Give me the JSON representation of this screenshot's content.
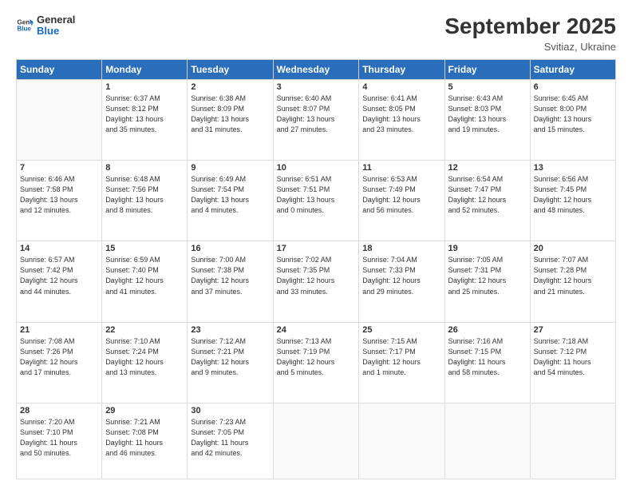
{
  "header": {
    "logo_general": "General",
    "logo_blue": "Blue",
    "month_title": "September 2025",
    "subtitle": "Svitiaz, Ukraine"
  },
  "weekdays": [
    "Sunday",
    "Monday",
    "Tuesday",
    "Wednesday",
    "Thursday",
    "Friday",
    "Saturday"
  ],
  "weeks": [
    [
      {
        "day": "",
        "info": ""
      },
      {
        "day": "1",
        "info": "Sunrise: 6:37 AM\nSunset: 8:12 PM\nDaylight: 13 hours\nand 35 minutes."
      },
      {
        "day": "2",
        "info": "Sunrise: 6:38 AM\nSunset: 8:09 PM\nDaylight: 13 hours\nand 31 minutes."
      },
      {
        "day": "3",
        "info": "Sunrise: 6:40 AM\nSunset: 8:07 PM\nDaylight: 13 hours\nand 27 minutes."
      },
      {
        "day": "4",
        "info": "Sunrise: 6:41 AM\nSunset: 8:05 PM\nDaylight: 13 hours\nand 23 minutes."
      },
      {
        "day": "5",
        "info": "Sunrise: 6:43 AM\nSunset: 8:03 PM\nDaylight: 13 hours\nand 19 minutes."
      },
      {
        "day": "6",
        "info": "Sunrise: 6:45 AM\nSunset: 8:00 PM\nDaylight: 13 hours\nand 15 minutes."
      }
    ],
    [
      {
        "day": "7",
        "info": "Sunrise: 6:46 AM\nSunset: 7:58 PM\nDaylight: 13 hours\nand 12 minutes."
      },
      {
        "day": "8",
        "info": "Sunrise: 6:48 AM\nSunset: 7:56 PM\nDaylight: 13 hours\nand 8 minutes."
      },
      {
        "day": "9",
        "info": "Sunrise: 6:49 AM\nSunset: 7:54 PM\nDaylight: 13 hours\nand 4 minutes."
      },
      {
        "day": "10",
        "info": "Sunrise: 6:51 AM\nSunset: 7:51 PM\nDaylight: 13 hours\nand 0 minutes."
      },
      {
        "day": "11",
        "info": "Sunrise: 6:53 AM\nSunset: 7:49 PM\nDaylight: 12 hours\nand 56 minutes."
      },
      {
        "day": "12",
        "info": "Sunrise: 6:54 AM\nSunset: 7:47 PM\nDaylight: 12 hours\nand 52 minutes."
      },
      {
        "day": "13",
        "info": "Sunrise: 6:56 AM\nSunset: 7:45 PM\nDaylight: 12 hours\nand 48 minutes."
      }
    ],
    [
      {
        "day": "14",
        "info": "Sunrise: 6:57 AM\nSunset: 7:42 PM\nDaylight: 12 hours\nand 44 minutes."
      },
      {
        "day": "15",
        "info": "Sunrise: 6:59 AM\nSunset: 7:40 PM\nDaylight: 12 hours\nand 41 minutes."
      },
      {
        "day": "16",
        "info": "Sunrise: 7:00 AM\nSunset: 7:38 PM\nDaylight: 12 hours\nand 37 minutes."
      },
      {
        "day": "17",
        "info": "Sunrise: 7:02 AM\nSunset: 7:35 PM\nDaylight: 12 hours\nand 33 minutes."
      },
      {
        "day": "18",
        "info": "Sunrise: 7:04 AM\nSunset: 7:33 PM\nDaylight: 12 hours\nand 29 minutes."
      },
      {
        "day": "19",
        "info": "Sunrise: 7:05 AM\nSunset: 7:31 PM\nDaylight: 12 hours\nand 25 minutes."
      },
      {
        "day": "20",
        "info": "Sunrise: 7:07 AM\nSunset: 7:28 PM\nDaylight: 12 hours\nand 21 minutes."
      }
    ],
    [
      {
        "day": "21",
        "info": "Sunrise: 7:08 AM\nSunset: 7:26 PM\nDaylight: 12 hours\nand 17 minutes."
      },
      {
        "day": "22",
        "info": "Sunrise: 7:10 AM\nSunset: 7:24 PM\nDaylight: 12 hours\nand 13 minutes."
      },
      {
        "day": "23",
        "info": "Sunrise: 7:12 AM\nSunset: 7:21 PM\nDaylight: 12 hours\nand 9 minutes."
      },
      {
        "day": "24",
        "info": "Sunrise: 7:13 AM\nSunset: 7:19 PM\nDaylight: 12 hours\nand 5 minutes."
      },
      {
        "day": "25",
        "info": "Sunrise: 7:15 AM\nSunset: 7:17 PM\nDaylight: 12 hours\nand 1 minute."
      },
      {
        "day": "26",
        "info": "Sunrise: 7:16 AM\nSunset: 7:15 PM\nDaylight: 11 hours\nand 58 minutes."
      },
      {
        "day": "27",
        "info": "Sunrise: 7:18 AM\nSunset: 7:12 PM\nDaylight: 11 hours\nand 54 minutes."
      }
    ],
    [
      {
        "day": "28",
        "info": "Sunrise: 7:20 AM\nSunset: 7:10 PM\nDaylight: 11 hours\nand 50 minutes."
      },
      {
        "day": "29",
        "info": "Sunrise: 7:21 AM\nSunset: 7:08 PM\nDaylight: 11 hours\nand 46 minutes."
      },
      {
        "day": "30",
        "info": "Sunrise: 7:23 AM\nSunset: 7:05 PM\nDaylight: 11 hours\nand 42 minutes."
      },
      {
        "day": "",
        "info": ""
      },
      {
        "day": "",
        "info": ""
      },
      {
        "day": "",
        "info": ""
      },
      {
        "day": "",
        "info": ""
      }
    ]
  ]
}
